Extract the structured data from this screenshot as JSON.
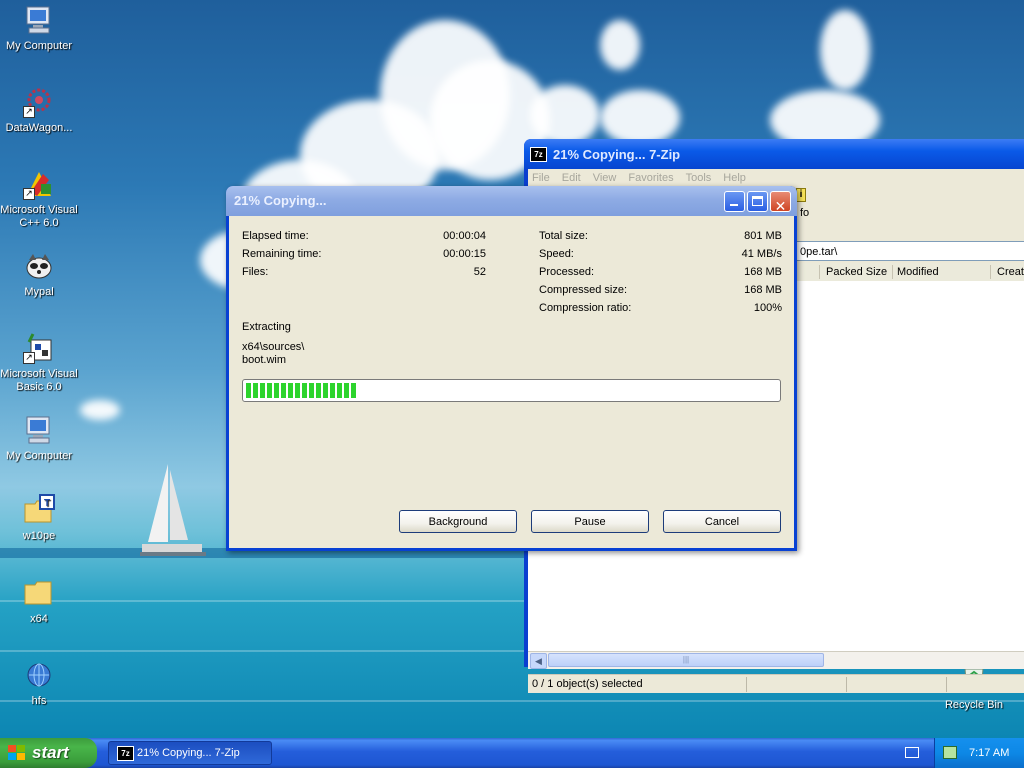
{
  "desktop": {
    "icons": [
      {
        "label": "My Computer",
        "icon": "my-computer-icon"
      },
      {
        "label": "DataWagon...",
        "icon": "datawagon-icon"
      },
      {
        "label": "Microsoft Visual C++ 6.0",
        "icon": "visual-cpp-icon"
      },
      {
        "label": "Mypal",
        "icon": "mypal-icon"
      },
      {
        "label": "Microsoft Visual Basic 6.0",
        "icon": "visual-basic-icon"
      },
      {
        "label": "My Computer",
        "icon": "my-computer-icon"
      },
      {
        "label": "w10pe",
        "icon": "folder-icon"
      },
      {
        "label": "x64",
        "icon": "folder-icon"
      },
      {
        "label": "hfs",
        "icon": "hfs-icon"
      },
      {
        "label": "Recycle Bin",
        "icon": "recycle-bin-icon"
      }
    ]
  },
  "zip_window": {
    "title": "21% Copying... 7-Zip",
    "app_icon": "7z",
    "menu": [
      "File",
      "Edit",
      "View",
      "Favorites",
      "Tools",
      "Help"
    ],
    "toolbar_partial_label": "fo",
    "address": "0pe.tar\\",
    "columns": [
      "Packed Size",
      "Modified",
      "Creat"
    ],
    "status": "0 / 1 object(s) selected"
  },
  "dialog": {
    "title": "21% Copying...",
    "left_stats": [
      {
        "label": "Elapsed time:",
        "value": "00:00:04"
      },
      {
        "label": "Remaining time:",
        "value": "00:00:15"
      },
      {
        "label": "Files:",
        "value": "52"
      }
    ],
    "right_stats": [
      {
        "label": "Total size:",
        "value": "801 MB"
      },
      {
        "label": "Speed:",
        "value": "41 MB/s"
      },
      {
        "label": "Processed:",
        "value": "168 MB"
      },
      {
        "label": "Compressed size:",
        "value": "168 MB"
      },
      {
        "label": "Compression ratio:",
        "value": "100%"
      }
    ],
    "action": "Extracting",
    "path_line1": "x64\\sources\\",
    "path_line2": "boot.wim",
    "progress_percent": 21,
    "buttons": {
      "background": "Background",
      "pause": "Pause",
      "cancel": "Cancel"
    }
  },
  "taskbar": {
    "start_label": "start",
    "task_item": "21% Copying... 7-Zip",
    "clock": "7:17 AM"
  },
  "colors": {
    "taskbar_blue": "#245edb",
    "start_green": "#3a9d3a",
    "progress_green": "#2dd42d",
    "dialog_face": "#ece9d8"
  }
}
